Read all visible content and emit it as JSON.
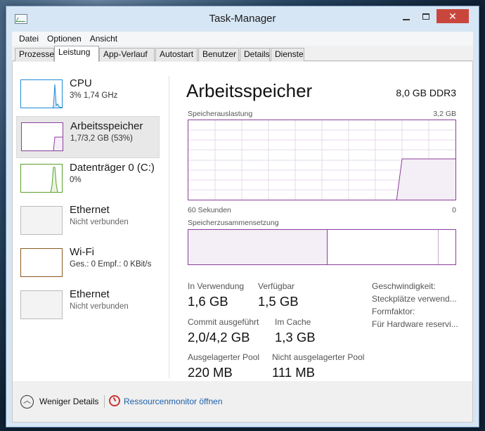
{
  "window": {
    "title": "Task-Manager"
  },
  "menu": [
    "Datei",
    "Optionen",
    "Ansicht"
  ],
  "tabs": [
    "Prozesse",
    "Leistung",
    "App-Verlauf",
    "Autostart",
    "Benutzer",
    "Details",
    "Dienste"
  ],
  "active_tab": "Leistung",
  "sidebar": [
    {
      "name": "CPU",
      "sub": "3%  1,74 GHz",
      "color": "#1f8bd6",
      "selected": false
    },
    {
      "name": "Arbeitsspeicher",
      "sub": "1,7/3,2 GB (53%)",
      "color": "#8b3e9b",
      "selected": true
    },
    {
      "name": "Datenträger 0 (C:)",
      "sub": "0%",
      "color": "#5aa02c",
      "selected": false
    },
    {
      "name": "Ethernet",
      "sub": "Nicht verbunden",
      "color": "#999999",
      "selected": false
    },
    {
      "name": "Wi-Fi",
      "sub": "Ges.: 0 Empf.: 0 KBit/s",
      "color": "#8a5a1f",
      "selected": false
    },
    {
      "name": "Ethernet",
      "sub": "Nicht verbunden",
      "color": "#999999",
      "selected": false
    }
  ],
  "main": {
    "title": "Arbeitsspeicher",
    "spec": "8,0 GB DDR3",
    "usage_label": "Speicherauslastung",
    "usage_max": "3,2 GB",
    "time_label": "60 Sekunden",
    "time_end": "0",
    "composition_label": "Speicherzusammensetzung",
    "stats": {
      "in_use_label": "In Verwendung",
      "in_use": "1,6 GB",
      "available_label": "Verfügbar",
      "available": "1,5 GB",
      "commit_label": "Commit ausgeführt",
      "commit": "2,0/4,2 GB",
      "cache_label": "Im Cache",
      "cache": "1,3 GB",
      "paged_label": "Ausgelagerter Pool",
      "paged": "220 MB",
      "nonpaged_label": "Nicht ausgelagerter Pool",
      "nonpaged": "111 MB"
    },
    "right_labels": [
      "Geschwindigkeit:",
      "Steckplätze verwend...",
      "Formfaktor:",
      "Für Hardware reservi..."
    ]
  },
  "footer": {
    "less_details": "Weniger Details",
    "resource_monitor": "Ressourcenmonitor öffnen"
  },
  "colors": {
    "memory": "#8b3e9b",
    "cpu": "#1f8bd6",
    "disk": "#5aa02c",
    "wifi": "#8a5a1f",
    "link": "#1c5fa8"
  }
}
